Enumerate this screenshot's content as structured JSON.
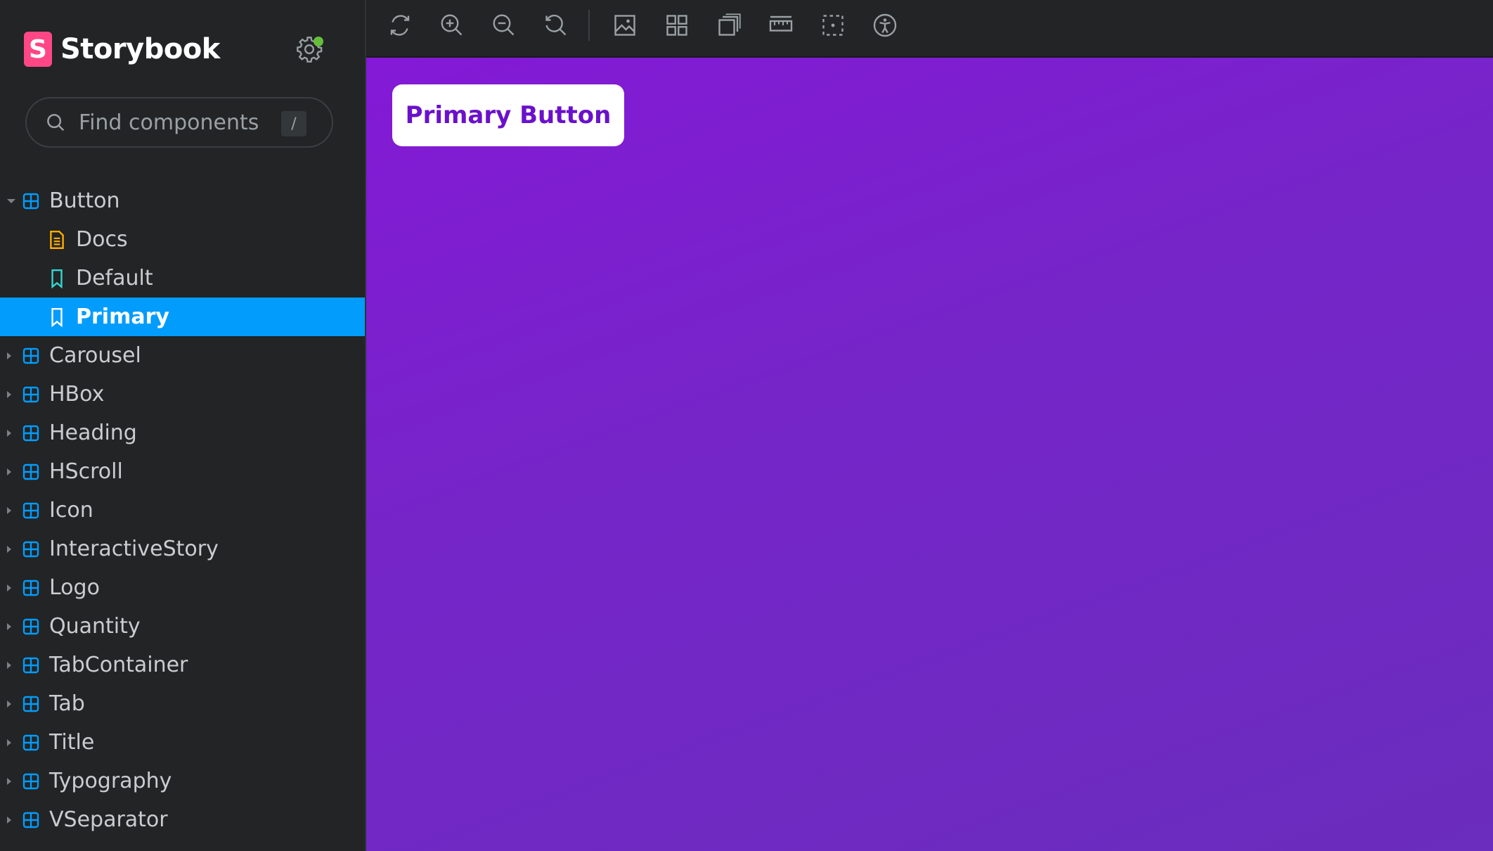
{
  "brand": {
    "name": "Storybook",
    "logo_letter": "S",
    "accent": "#ff4785"
  },
  "search": {
    "placeholder": "Find components",
    "shortcut": "/"
  },
  "tree": {
    "button": {
      "label": "Button",
      "expanded": true,
      "stories": [
        {
          "label": "Docs",
          "icon": "docs-icon"
        },
        {
          "label": "Default",
          "icon": "bookmark-icon"
        },
        {
          "label": "Primary",
          "icon": "bookmark-icon",
          "selected": true
        }
      ]
    },
    "components": [
      "Carousel",
      "HBox",
      "Heading",
      "HScroll",
      "Icon",
      "InteractiveStory",
      "Logo",
      "Quantity",
      "TabContainer",
      "Tab",
      "Title",
      "Typography",
      "VSeparator"
    ]
  },
  "toolbar": {
    "icons": [
      "reload-icon",
      "zoom-in-icon",
      "zoom-out-icon",
      "zoom-reset-icon",
      "background-icon",
      "grid-icon",
      "viewport-icon",
      "measure-icon",
      "outline-icon",
      "accessibility-icon"
    ]
  },
  "preview": {
    "button_label": "Primary Button"
  },
  "colors": {
    "selected": "#029cfd",
    "component_icon": "#029cfd",
    "docs_icon": "#ffae00",
    "story_icon": "#37d5d3",
    "status_dot": "#66bf3c"
  }
}
